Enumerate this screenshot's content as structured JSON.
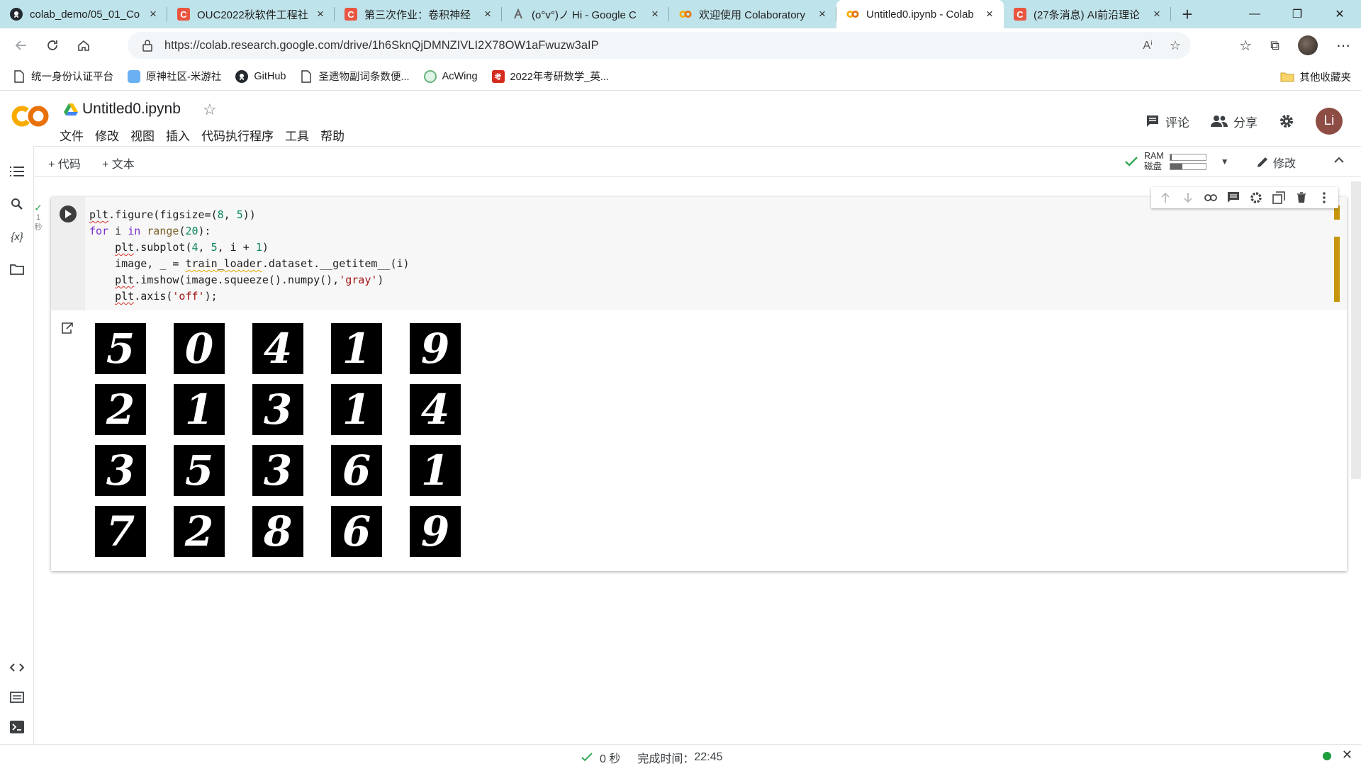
{
  "browser": {
    "tabs": [
      {
        "title": "colab_demo/05_01_Co",
        "favicon": "github-icon"
      },
      {
        "title": "OUC2022秋软件工程社",
        "favicon": "csdn-icon"
      },
      {
        "title": "第三次作业：卷积神经",
        "favicon": "csdn-icon"
      },
      {
        "title": "(o°v°)ノ Hi - Google C",
        "favicon": "google-scholar-icon"
      },
      {
        "title": "欢迎使用 Colaboratory",
        "favicon": "colab-icon"
      },
      {
        "title": "Untitled0.ipynb - Colab",
        "favicon": "colab-icon",
        "active": true
      },
      {
        "title": "(27条消息) AI前沿理论",
        "favicon": "csdn-icon"
      }
    ],
    "url": "https://colab.research.google.com/drive/1h6SknQjDMNZIVLI2X78OW1aFwuzw3aIP",
    "bookmarks": [
      {
        "label": "统一身份认证平台",
        "icon": "page-icon"
      },
      {
        "label": "原神社区-米游社",
        "icon": "miyoushe-icon"
      },
      {
        "label": "GitHub",
        "icon": "github-icon"
      },
      {
        "label": "圣遗物副词条数便...",
        "icon": "page-icon"
      },
      {
        "label": "AcWing",
        "icon": "acwing-icon"
      },
      {
        "label": "2022年考研数学_英...",
        "icon": "red-logo-icon"
      }
    ],
    "other_bookmarks": "其他收藏夹"
  },
  "colab": {
    "filename": "Untitled0.ipynb",
    "menu": [
      "文件",
      "修改",
      "视图",
      "插入",
      "代码执行程序",
      "工具",
      "帮助"
    ],
    "comment_label": "评论",
    "share_label": "分享",
    "user_initial": "Li",
    "toolbar": {
      "add_code": "+ 代码",
      "add_text": "+ 文本",
      "ram_label": "RAM",
      "disk_label": "磁盘",
      "ram_fill": 0.05,
      "disk_fill": 0.35,
      "edit_label": "修改"
    },
    "cell": {
      "exec_time": "1\n秒",
      "code_lines": [
        "plt.figure(figsize=(8, 5))",
        "for i in range(20):",
        "    plt.subplot(4, 5, i + 1)",
        "    image, _ = train_loader.dataset.__getitem__(i)",
        "    plt.imshow(image.squeeze().numpy(),'gray')",
        "    plt.axis('off');"
      ],
      "output_digits": [
        "5",
        "0",
        "4",
        "1",
        "9",
        "2",
        "1",
        "3",
        "1",
        "4",
        "3",
        "5",
        "3",
        "6",
        "1",
        "7",
        "2",
        "8",
        "6",
        "9"
      ]
    },
    "status": {
      "elapsed": "0 秒",
      "completed_label": "完成时间：",
      "completed_time": "22:45",
      "connected_color": "#1e9e3e"
    }
  }
}
